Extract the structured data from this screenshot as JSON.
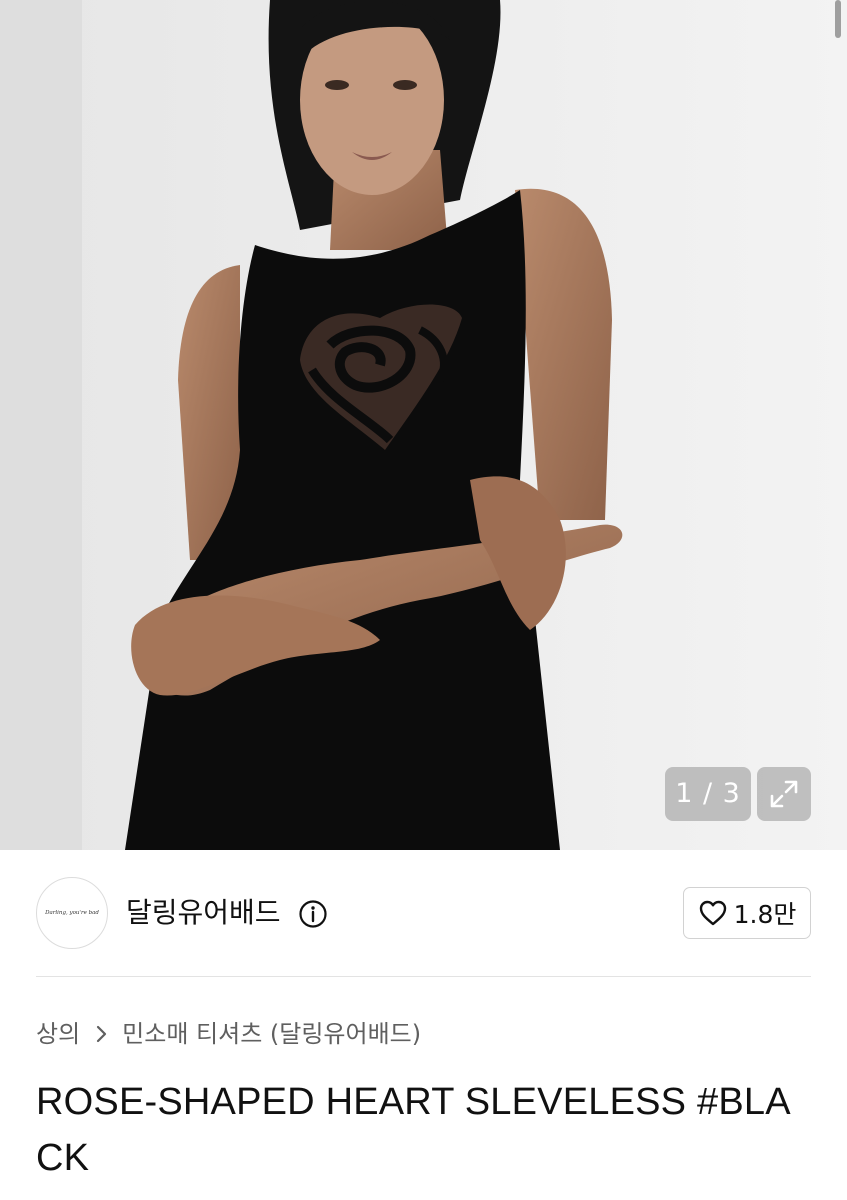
{
  "hero": {
    "image_counter": "1 / 3",
    "expand_icon": "expand-icon"
  },
  "seller": {
    "avatar_text": "Darling, you're bad",
    "name": "달링유어배드",
    "info_icon": "info-icon",
    "like_icon": "heart-icon",
    "like_count": "1.8만"
  },
  "breadcrumb": {
    "level1": "상의",
    "separator_icon": "chevron-right-icon",
    "level2": "민소매 티셔츠 (달링유어배드)"
  },
  "product": {
    "title": "ROSE-SHAPED HEART SLEVELESS #BLACK"
  },
  "colors": {
    "text_primary": "#111111",
    "text_secondary": "#5f5f5f",
    "border": "#d2d2d2",
    "overlay": "#aaaaaa"
  }
}
